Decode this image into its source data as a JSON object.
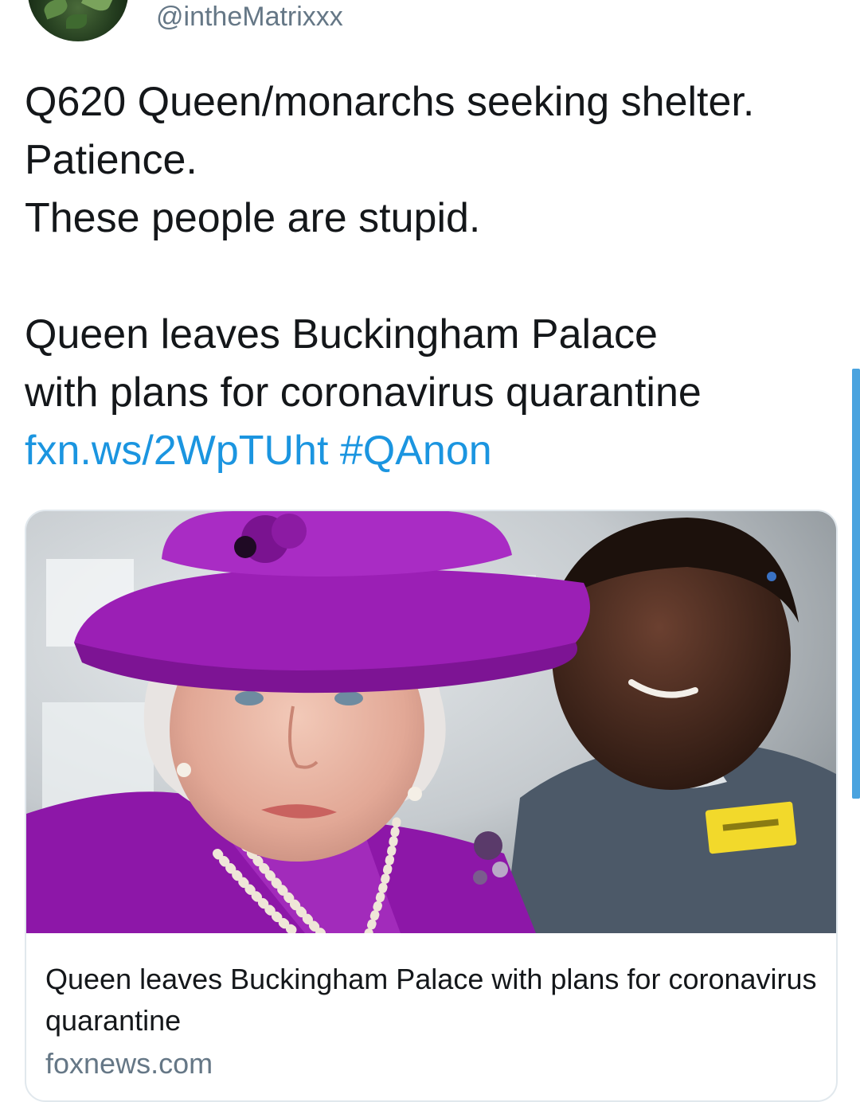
{
  "tweet": {
    "handle": "@intheMatrixxx",
    "lines": [
      "Q620 Queen/monarchs seeking shelter.",
      "Patience.",
      "These people are stupid."
    ],
    "headline_lines": [
      "Queen leaves Buckingham Palace",
      "with plans for coronavirus quarantine"
    ],
    "link_text": "fxn.ws/2WpTUht",
    "hashtag": "#QAnon"
  },
  "card": {
    "image_icon": "news-photo-queen-purple-hat",
    "title": "Queen leaves Buckingham Palace with plans for coronavirus quarantine",
    "domain": "foxnews.com"
  },
  "colors": {
    "text": "#14171a",
    "secondary": "#657786",
    "link": "#1b95e0",
    "hat_purple": "#9b1fb5",
    "card_border": "#e1e8ed"
  }
}
